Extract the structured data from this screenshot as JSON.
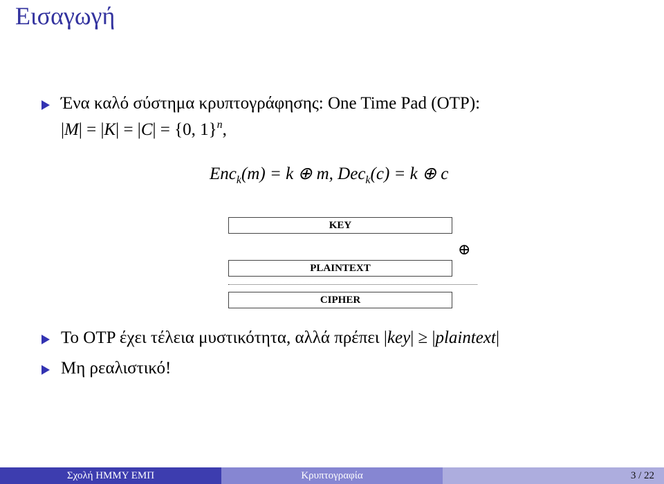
{
  "slide": {
    "title": "Εισαγωγή",
    "bullets": [
      {
        "line1": "Ένα καλό σύστημα κρυπτογράφησης: One Time Pad (OTP):",
        "line2_math": {
          "M": "M",
          "K": "K",
          "C": "C",
          "eq": "=",
          "set": "{0, 1}",
          "exp": "n",
          "trail": ","
        }
      },
      {
        "text": "Το OTP έχει τέλεια μυστικότητα, αλλά πρέπει",
        "math_left": "key",
        "geq": "≥",
        "math_right": "plaintext"
      },
      {
        "text": "Μη ρεαλιστικό!"
      }
    ],
    "equation": {
      "enc": "Enc",
      "dec": "Dec",
      "sub": "k",
      "enc_arg": "(m)",
      "dec_arg": "(c)",
      "enc_rhs": "= k ⊕ m,",
      "dec_rhs": "= k ⊕ c"
    },
    "diagram": {
      "key_label": "KEY",
      "plaintext_label": "PLAINTEXT",
      "cipher_label": "CIPHER",
      "operator": "⊕"
    }
  },
  "footer": {
    "institution": "Σχολή ΗΜΜΥ ΕΜΠ",
    "topic": "Κρυπτογραφία",
    "page": "3 / 22"
  },
  "colors": {
    "title": "#33339f",
    "bullet": "#3333b2",
    "footer_left": "#3d3daf",
    "footer_mid": "#8686d2",
    "footer_right": "#adadde"
  }
}
